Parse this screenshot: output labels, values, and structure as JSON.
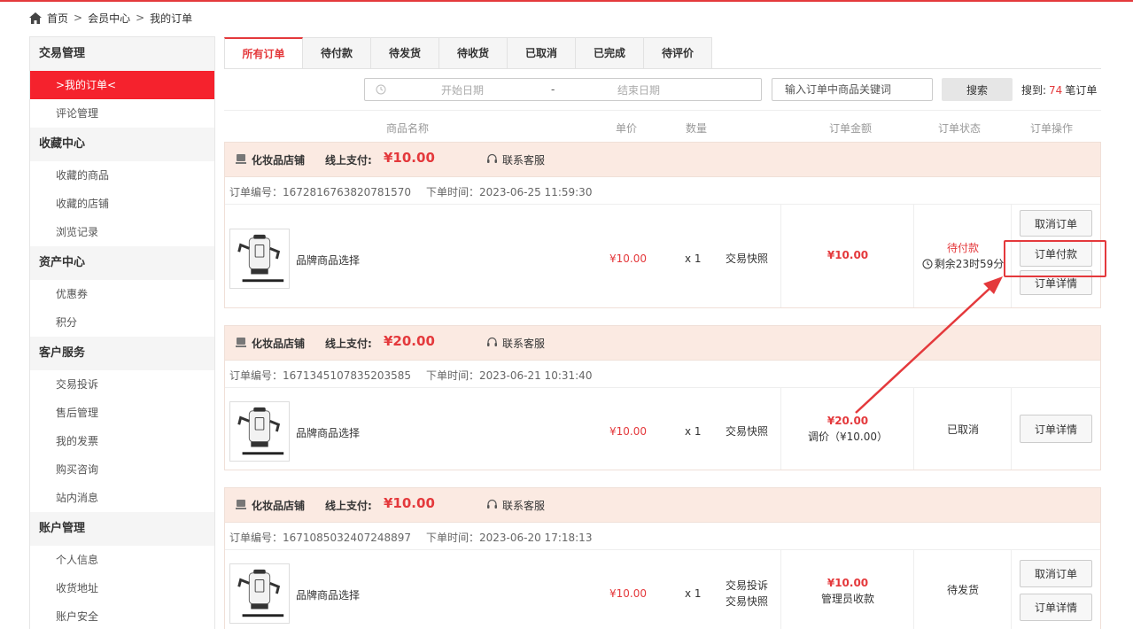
{
  "breadcrumb": {
    "items": [
      "首页",
      "会员中心",
      "我的订单"
    ],
    "sep": ">"
  },
  "sidebar": {
    "groups": [
      {
        "title": "交易管理",
        "items": [
          ">我的订单<",
          "评论管理"
        ]
      },
      {
        "title": "收藏中心",
        "items": [
          "收藏的商品",
          "收藏的店铺",
          "浏览记录"
        ]
      },
      {
        "title": "资产中心",
        "items": [
          "优惠券",
          "积分"
        ]
      },
      {
        "title": "客户服务",
        "items": [
          "交易投诉",
          "售后管理",
          "我的发票",
          "购买咨询",
          "站内消息"
        ]
      },
      {
        "title": "账户管理",
        "items": [
          "个人信息",
          "收货地址",
          "账户安全"
        ]
      }
    ]
  },
  "tabs": [
    "所有订单",
    "待付款",
    "待发货",
    "待收货",
    "已取消",
    "已完成",
    "待评价"
  ],
  "search": {
    "start_placeholder": "开始日期",
    "dash": "-",
    "end_placeholder": "结束日期",
    "keyword_placeholder": "输入订单中商品关键词",
    "button": "搜索",
    "result_prefix": "搜到:",
    "result_count": "74",
    "result_suffix": "笔订单"
  },
  "table_header": {
    "product": "商品名称",
    "price": "单价",
    "qty": "数量",
    "amount": "订单金额",
    "status": "订单状态",
    "ops": "订单操作"
  },
  "orders": [
    {
      "shop": "化妆品店铺",
      "pay_label": "线上支付:",
      "pay_amount": "¥10.00",
      "service": "联系客服",
      "order_no": "订单编号：1672816763820781570",
      "order_time": "下单时间：2023-06-25 11:59:30",
      "product": "品牌商品选择",
      "unit_price": "¥10.00",
      "qty": "x 1",
      "links": [
        "交易快照"
      ],
      "total": "¥10.00",
      "total_note": "",
      "status": "待付款",
      "remain": "剩余23时59分",
      "buttons": [
        "取消订单",
        "订单付款",
        "订单详情"
      ]
    },
    {
      "shop": "化妆品店铺",
      "pay_label": "线上支付:",
      "pay_amount": "¥20.00",
      "service": "联系客服",
      "order_no": "订单编号：1671345107835203585",
      "order_time": "下单时间：2023-06-21 10:31:40",
      "product": "品牌商品选择",
      "unit_price": "¥10.00",
      "qty": "x 1",
      "links": [
        "交易快照"
      ],
      "total": "¥20.00",
      "total_note": "调价（¥10.00）",
      "status": "已取消",
      "buttons": [
        "订单详情"
      ]
    },
    {
      "shop": "化妆品店铺",
      "pay_label": "线上支付:",
      "pay_amount": "¥10.00",
      "service": "联系客服",
      "order_no": "订单编号：1671085032407248897",
      "order_time": "下单时间：2023-06-20 17:18:13",
      "product": "品牌商品选择",
      "unit_price": "¥10.00",
      "qty": "x 1",
      "links": [
        "交易投诉",
        "交易快照"
      ],
      "total": "¥10.00",
      "total_note": "管理员收款",
      "status": "待发货",
      "buttons": [
        "取消订单",
        "订单详情"
      ]
    }
  ],
  "colors": {
    "accent": "#e4393c",
    "active_nav": "#f5222d",
    "order_head_bg": "#fbeae2"
  },
  "icons": [
    "home-icon",
    "clock-icon",
    "shop-icon",
    "headset-icon",
    "product-thumbnail"
  ]
}
